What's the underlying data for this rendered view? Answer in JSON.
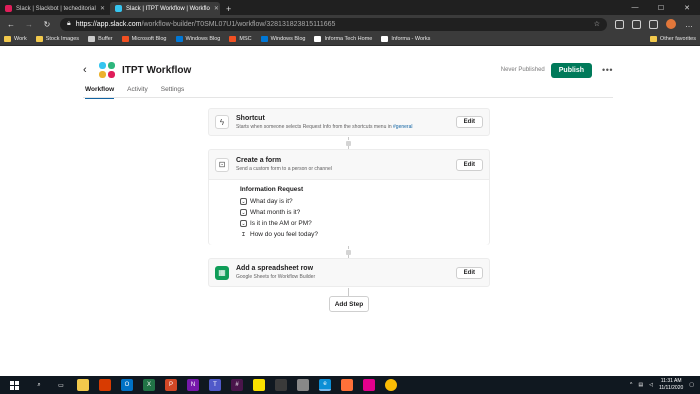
{
  "browser": {
    "tabs": [
      {
        "title": "Slack | Slackbot | techeditorial",
        "fav_color": "#e01e5a",
        "active": false
      },
      {
        "title": "Slack | ITPT Workflow | Workflo",
        "fav_color": "#36c5f0",
        "active": true
      }
    ],
    "new_tab": "+",
    "url_host": "https://app.slack.com",
    "url_path": "/workflow-builder/T0SML07U1/workflow/328131823815111665",
    "bookmarks": [
      {
        "label": "Work",
        "color": "#f2c94c"
      },
      {
        "label": "Stock Images",
        "color": "#f2c94c"
      },
      {
        "label": "Buffer",
        "color": "#cccccc"
      },
      {
        "label": "Microsoft Blog",
        "color": "#f25022"
      },
      {
        "label": "Windows Blog",
        "color": "#0078d7"
      },
      {
        "label": "MSC",
        "color": "#f25022"
      },
      {
        "label": "Windows Blog",
        "color": "#0078d7"
      },
      {
        "label": "Informa Tech Home",
        "color": "#ffffff"
      },
      {
        "label": "Informa - Works",
        "color": "#ffffff"
      }
    ],
    "other_favorites": "Other favorites"
  },
  "header": {
    "title": "ITPT Workflow",
    "status": "Never Published",
    "publish_label": "Publish",
    "more_label": "•••"
  },
  "tabs": [
    "Workflow",
    "Activity",
    "Settings"
  ],
  "steps": {
    "shortcut": {
      "title": "Shortcut",
      "desc": "Starts when someone selects Request Info from the shortcuts menu in",
      "channel": "#general",
      "edit_label": "Edit"
    },
    "form": {
      "title": "Create a form",
      "desc": "Send a custom form to a person or channel",
      "edit_label": "Edit",
      "form_name": "Information Request",
      "questions": [
        "What day is it?",
        "What month is it?",
        "Is it in the AM or PM?",
        "How do you feel today?"
      ]
    },
    "sheet": {
      "title": "Add a spreadsheet row",
      "desc": "Google Sheets for Workflow Builder",
      "edit_label": "Edit"
    }
  },
  "add_step_label": "Add Step",
  "taskbar": {
    "time": "11:31 AM",
    "date": "11/11/2020"
  },
  "colors": {
    "publish": "#007a5a",
    "link": "#1264a3",
    "tab_underline": "#1264a3"
  }
}
